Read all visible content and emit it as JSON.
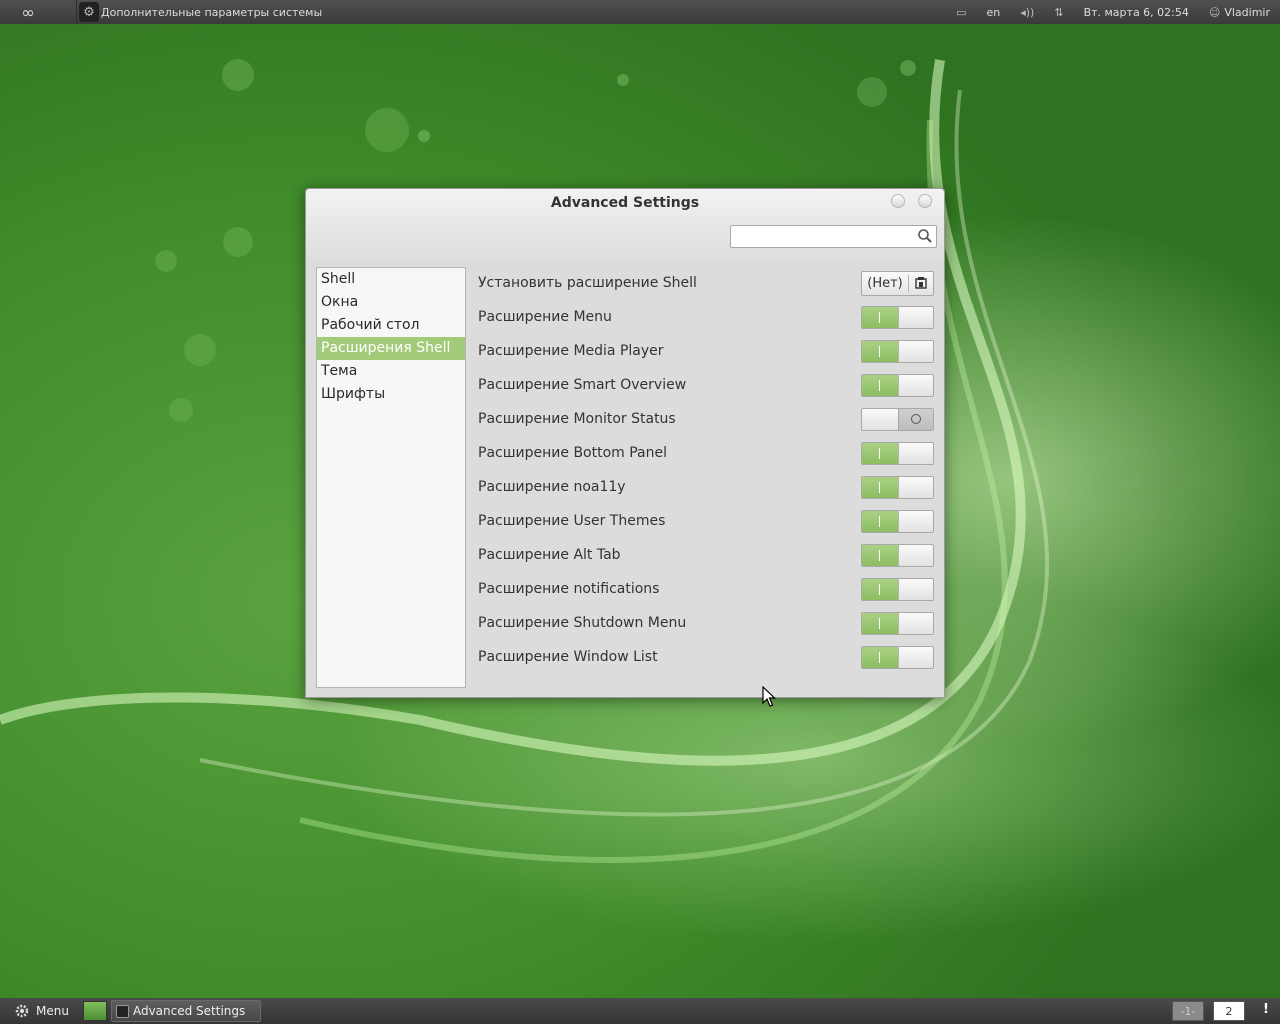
{
  "top_panel": {
    "logo_icon": "infinity-icon",
    "active_app_title": "Дополнительные параметры системы",
    "keyboard_layout": "en",
    "datetime": "Вт. марта  6, 02:54",
    "user": "Vladimir"
  },
  "window": {
    "title": "Advanced Settings",
    "search": {
      "value": "",
      "placeholder": ""
    },
    "sidebar": {
      "items": [
        {
          "label": "Shell"
        },
        {
          "label": "Окна"
        },
        {
          "label": "Рабочий стол"
        },
        {
          "label": "Расширения Shell"
        },
        {
          "label": "Тема"
        },
        {
          "label": "Шрифты"
        }
      ],
      "selected_index": 3
    },
    "install_row": {
      "label": "Установить расширение Shell",
      "button_label": "(Нет)"
    },
    "extensions": [
      {
        "label": "Расширение Menu",
        "on": true
      },
      {
        "label": "Расширение Media Player",
        "on": true
      },
      {
        "label": "Расширение Smart Overview",
        "on": true
      },
      {
        "label": "Расширение Monitor Status",
        "on": false
      },
      {
        "label": "Расширение Bottom Panel",
        "on": true
      },
      {
        "label": "Расширение noa11y",
        "on": true
      },
      {
        "label": "Расширение User Themes",
        "on": true
      },
      {
        "label": "Расширение Alt Tab",
        "on": true
      },
      {
        "label": "Расширение notifications",
        "on": true
      },
      {
        "label": "Расширение Shutdown Menu",
        "on": true
      },
      {
        "label": "Расширение Window List",
        "on": true
      }
    ]
  },
  "bottom_panel": {
    "menu_label": "Menu",
    "task_label": "Advanced Settings",
    "workspaces": [
      "-1-",
      "2"
    ],
    "notification_mark": "!"
  },
  "colors": {
    "accent": "#a2cb79",
    "toggle_on": "#8dbd63"
  }
}
